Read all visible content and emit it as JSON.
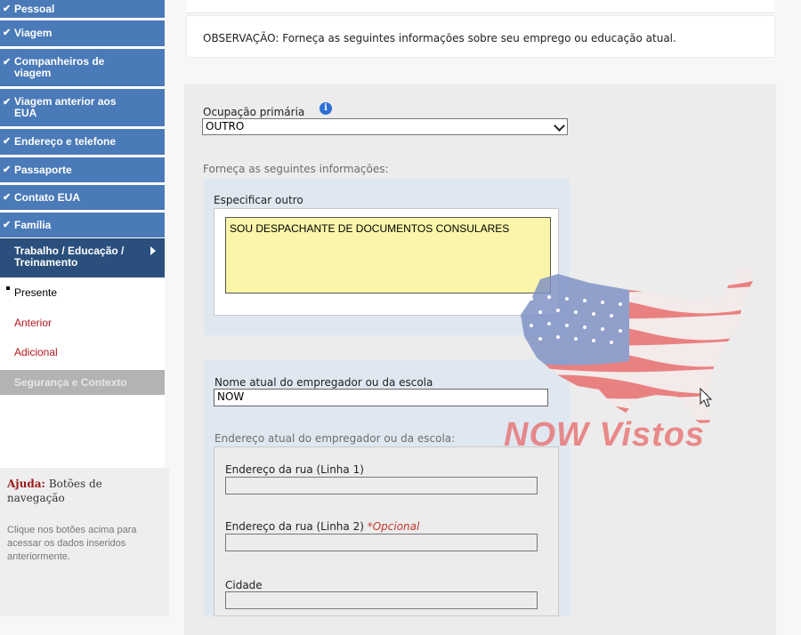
{
  "sidebar": {
    "completed_items": [
      {
        "label": "Pessoal"
      },
      {
        "label": "Viagem"
      },
      {
        "label": "Companheiros de viagem"
      },
      {
        "label": "Viagem anterior aos EUA"
      },
      {
        "label": "Endereço e telefone"
      },
      {
        "label": "Passaporte"
      },
      {
        "label": "Contato EUA"
      },
      {
        "label": "Família"
      }
    ],
    "check_glyph": "✔",
    "current_item": {
      "label": "Trabalho / Educação / Treinamento"
    },
    "sub_items": {
      "present": "Presente",
      "previous": "Anterior",
      "additional": "Adicional"
    },
    "disabled_item": {
      "label": "Segurança e Contexto"
    },
    "help": {
      "title_prefix": "Ajuda:",
      "title": "Botões de navegação",
      "text": "Clique nos botões acima para acessar os dados inseridos anteriormente."
    }
  },
  "note": {
    "text": "OBSERVAÇÃO: Forneça as seguintes informações sobre seu emprego ou educação atual."
  },
  "form": {
    "primary_occupation": {
      "label": "Ocupação primária",
      "info_icon": "i",
      "value": "OUTRO"
    },
    "provide_info_label": "Forneça as seguintes informações:",
    "specify_other": {
      "label": "Especificar outro",
      "value": "SOU DESPACHANTE DE DOCUMENTOS CONSULARES"
    },
    "employer_name": {
      "label": "Nome atual do empregador ou da escola",
      "value": "NOW"
    },
    "employer_address_label": "Endereço atual do empregador ou da escola:",
    "street1": {
      "label": "Endereço da rua (Linha 1)",
      "value": ""
    },
    "street2": {
      "label": "Endereço da rua (Linha 2)",
      "optional": "*Opcional",
      "value": ""
    },
    "city": {
      "label": "Cidade",
      "value": ""
    }
  },
  "watermark": {
    "text": "NOW Vistos"
  },
  "colors": {
    "nav_completed": "#4a7ab8",
    "nav_current": "#2a4f7d",
    "nav_disabled": "#b3b3b3",
    "link_red": "#b5141c",
    "textarea_yellow": "#faf5a8",
    "section_blue": "#dfe8f1"
  }
}
